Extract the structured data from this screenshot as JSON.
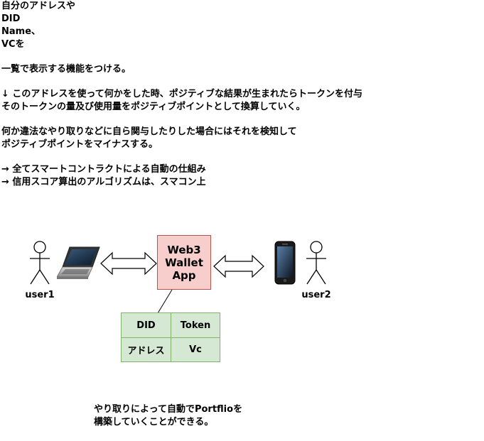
{
  "notes": [
    "自分のアドレスや",
    "DID",
    "Name、",
    "VCを",
    "",
    "一覧で表示する機能をつける。",
    "",
    "↓ このアドレスを使って何かをした時、ポジティブな結果が生まれたらトークンを付与",
    "そのトークンの量及び使用量をポジティブポイントとして換算していく。",
    "",
    "何か違法なやり取りなどに自ら関与したりした場合にはそれを検知して",
    "ポジティブポイントをマイナスする。",
    "",
    "→ 全てスマートコントラクトによる自動の仕組み",
    "→ 信用スコア算出のアルゴリズムは、スマコン上"
  ],
  "diagram": {
    "user1_label": "user1",
    "user2_label": "user2",
    "app": {
      "line1": "Web3",
      "line2": "Wallet",
      "line3": "App"
    },
    "app_fill": "#f8cecc",
    "app_stroke": "#b85450",
    "table": [
      [
        "DID",
        "Token"
      ],
      [
        "アドレス",
        "Vc"
      ]
    ],
    "table_fill": "#d5e8d4",
    "table_stroke": "#82b366"
  },
  "caption": [
    "やり取りによって自動でPortflioを",
    "構築していくことができる。"
  ]
}
